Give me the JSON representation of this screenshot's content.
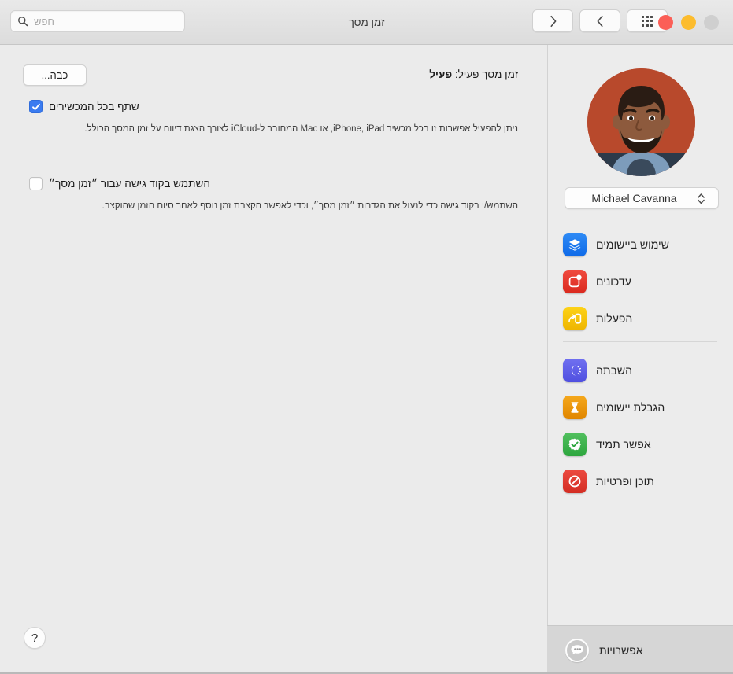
{
  "window": {
    "title": "זמן מסך",
    "traffic_lights": [
      {
        "name": "close",
        "color": "#cfcfcf"
      },
      {
        "name": "minimize",
        "color": "#fcbc2e"
      },
      {
        "name": "zoom",
        "color": "#fb5f57"
      }
    ]
  },
  "toolbar": {
    "search_placeholder": "חפש",
    "search_value": "",
    "show_all_label": "הצג הכל",
    "back_label": "חזור",
    "forward_label": "קדימה"
  },
  "sidebar": {
    "user_name": "Michael Cavanna",
    "groups": [
      {
        "items": [
          {
            "label": "שימוש ביישומים",
            "icon": "layers-icon",
            "color": "#1878f0"
          },
          {
            "label": "עדכונים",
            "icon": "notifications-icon",
            "color": "#e8372c"
          },
          {
            "label": "הפעלות",
            "icon": "pickups-icon",
            "color": "#f2c00c"
          }
        ]
      },
      {
        "items": [
          {
            "label": "השבתה",
            "icon": "downtime-icon",
            "color": "#5a5ae6"
          },
          {
            "label": "הגבלת יישומים",
            "icon": "hourglass-icon",
            "color": "#e8920c"
          },
          {
            "label": "אפשר תמיד",
            "icon": "always-allowed-icon",
            "color": "#3cb14a"
          },
          {
            "label": "תוכן ופרטיות",
            "icon": "content-privacy-icon",
            "color": "#e03b32"
          }
        ]
      }
    ],
    "options_label": "אפשרויות"
  },
  "main": {
    "status_prefix": "זמן מסך פעיל: ",
    "status_value": "פעיל",
    "turn_off_button": "כבה...",
    "share_checkbox": {
      "label": "שתף בכל המכשירים",
      "checked": "true",
      "description": "ניתן להפעיל אפשרות זו בכל מכשיר iPhone, iPad, או Mac המחובר ל-iCloud לצורך הצגת דיווח על זמן המסך הכולל."
    },
    "passcode_checkbox": {
      "label": "השתמש בקוד גישה עבור ״זמן מסך״",
      "checked": "false",
      "description": "השתמש/י בקוד גישה כדי לנעול את הגדרות ״זמן מסך״, וכדי לאפשר הקצבת זמן נוסף לאחר סיום הזמן שהוקצב."
    },
    "help_button": "?"
  }
}
